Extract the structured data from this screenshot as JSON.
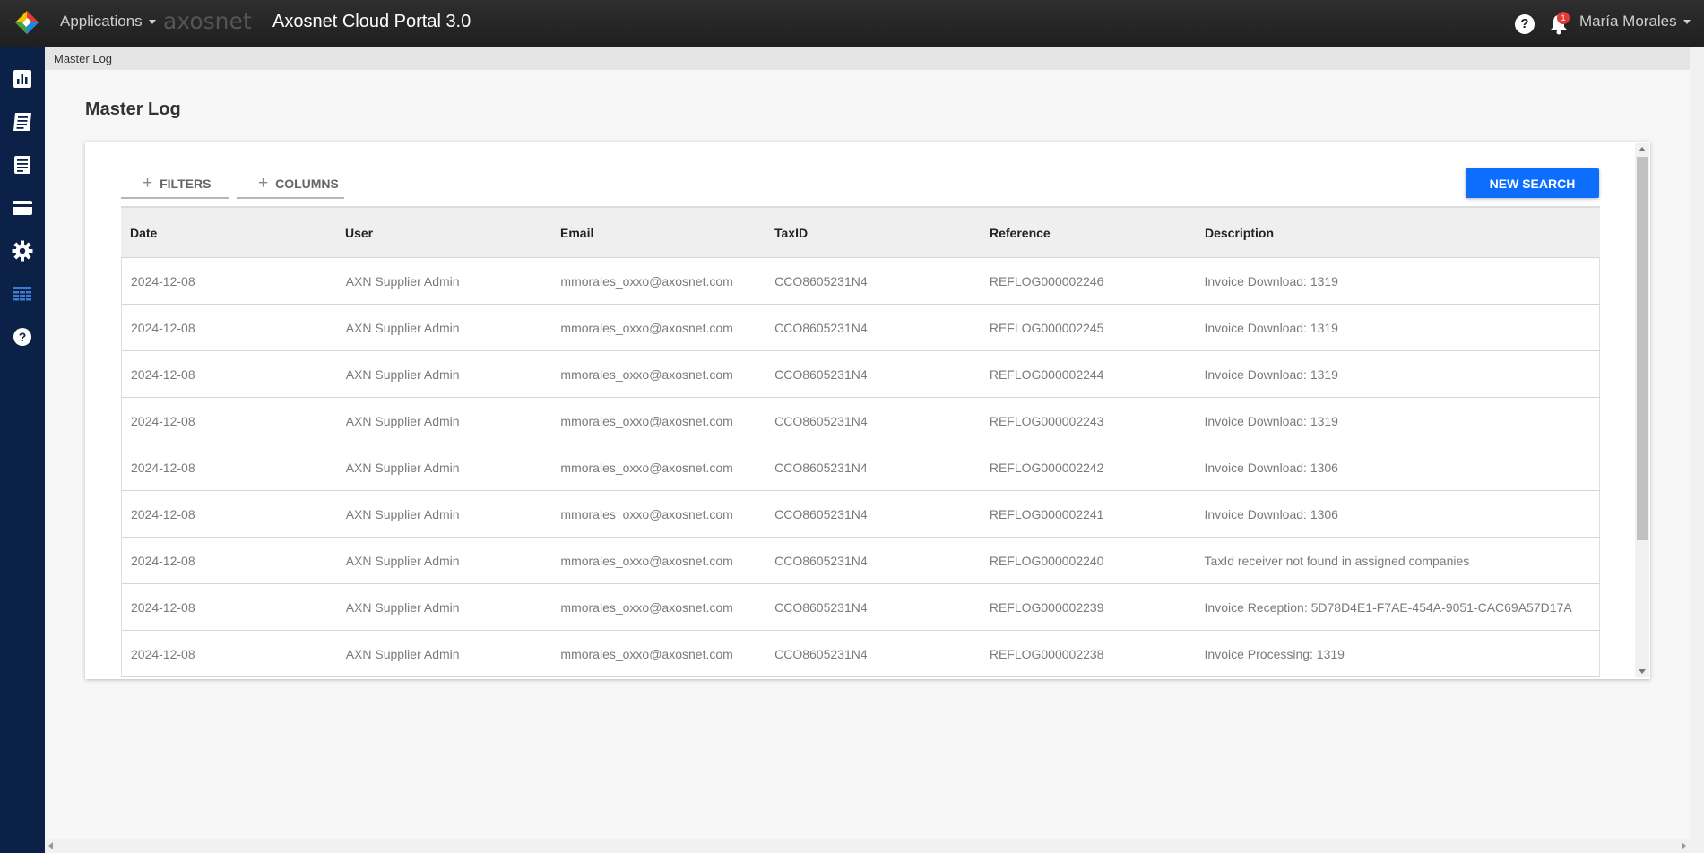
{
  "topbar": {
    "apps_label": "Applications",
    "brand_text": "axosnet",
    "portal_title": "Axosnet Cloud Portal 3.0",
    "help_glyph": "?",
    "notification_count": "1",
    "user_name": "María Morales"
  },
  "sidebar": {
    "items": [
      {
        "icon": "bar-chart-icon"
      },
      {
        "icon": "invoice-list-icon"
      },
      {
        "icon": "document-icon"
      },
      {
        "icon": "credit-card-icon"
      },
      {
        "icon": "gear-icon"
      },
      {
        "icon": "table-log-icon",
        "active": true
      },
      {
        "icon": "help-circle-icon"
      }
    ]
  },
  "breadcrumb": {
    "current": "Master Log"
  },
  "page": {
    "title": "Master Log"
  },
  "toolbar": {
    "filters_label": "FILTERS",
    "columns_label": "COLUMNS",
    "new_search_label": "NEW SEARCH"
  },
  "table": {
    "headers": [
      "Date",
      "User",
      "Email",
      "TaxID",
      "Reference",
      "Description"
    ],
    "rows": [
      [
        "2024-12-08",
        "AXN Supplier Admin",
        "mmorales_oxxo@axosnet.com",
        "CCO8605231N4",
        "REFLOG000002246",
        "Invoice Download: 1319"
      ],
      [
        "2024-12-08",
        "AXN Supplier Admin",
        "mmorales_oxxo@axosnet.com",
        "CCO8605231N4",
        "REFLOG000002245",
        "Invoice Download: 1319"
      ],
      [
        "2024-12-08",
        "AXN Supplier Admin",
        "mmorales_oxxo@axosnet.com",
        "CCO8605231N4",
        "REFLOG000002244",
        "Invoice Download: 1319"
      ],
      [
        "2024-12-08",
        "AXN Supplier Admin",
        "mmorales_oxxo@axosnet.com",
        "CCO8605231N4",
        "REFLOG000002243",
        "Invoice Download: 1319"
      ],
      [
        "2024-12-08",
        "AXN Supplier Admin",
        "mmorales_oxxo@axosnet.com",
        "CCO8605231N4",
        "REFLOG000002242",
        "Invoice Download: 1306"
      ],
      [
        "2024-12-08",
        "AXN Supplier Admin",
        "mmorales_oxxo@axosnet.com",
        "CCO8605231N4",
        "REFLOG000002241",
        "Invoice Download: 1306"
      ],
      [
        "2024-12-08",
        "AXN Supplier Admin",
        "mmorales_oxxo@axosnet.com",
        "CCO8605231N4",
        "REFLOG000002240",
        "TaxId receiver not found in assigned companies"
      ],
      [
        "2024-12-08",
        "AXN Supplier Admin",
        "mmorales_oxxo@axosnet.com",
        "CCO8605231N4",
        "REFLOG000002239",
        "Invoice Reception: 5D78D4E1-F7AE-454A-9051-CAC69A57D17A"
      ],
      [
        "2024-12-08",
        "AXN Supplier Admin",
        "mmorales_oxxo@axosnet.com",
        "CCO8605231N4",
        "REFLOG000002238",
        "Invoice Processing: 1319"
      ]
    ]
  },
  "colors": {
    "topbar": "#262626",
    "sidebar": "#0c2148",
    "accent": "#0d6efd",
    "active_icon": "#3a7bd5"
  }
}
